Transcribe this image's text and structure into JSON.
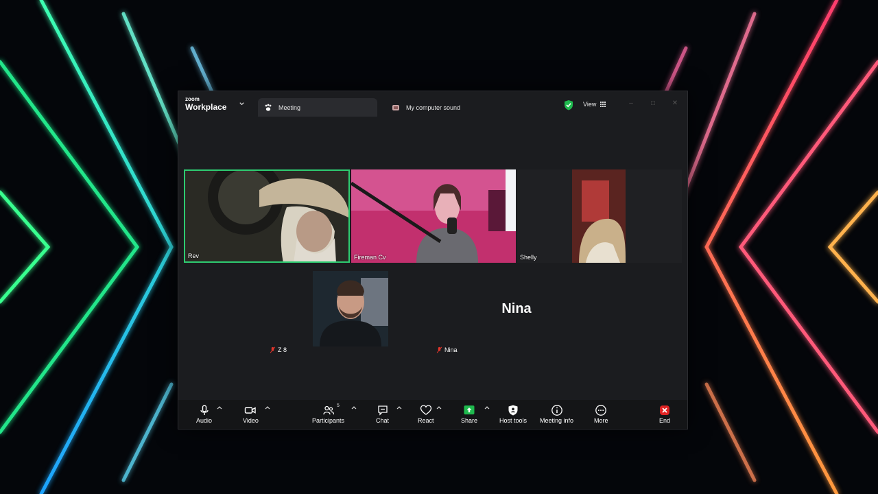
{
  "window": {
    "brand_small": "zoom",
    "brand_big": "Workplace",
    "tabs": [
      {
        "label": "Meeting",
        "icon": "participants-paw-icon"
      },
      {
        "label": "My computer sound",
        "icon": "screen-share-icon"
      }
    ],
    "view_label": "View"
  },
  "participants": {
    "tiles": [
      {
        "name": "Rev",
        "active_speaker": true
      },
      {
        "name": "Fireman Cv"
      },
      {
        "name": "Shelly"
      }
    ],
    "z8": {
      "name": "Z 8",
      "muted": true
    },
    "nina": {
      "name": "Nina",
      "display_name_big": "Nina",
      "muted": true
    }
  },
  "toolbar": {
    "audio": "Audio",
    "video": "Video",
    "participants": "Participants",
    "participants_count": "5",
    "chat": "Chat",
    "react": "React",
    "share": "Share",
    "host_tools": "Host tools",
    "meeting_info": "Meeting info",
    "more": "More",
    "end": "End"
  },
  "colors": {
    "active_speaker_border": "#2ecc71",
    "share_green": "#1fba4e",
    "end_red": "#e02424",
    "mute_red": "#e0352b"
  }
}
